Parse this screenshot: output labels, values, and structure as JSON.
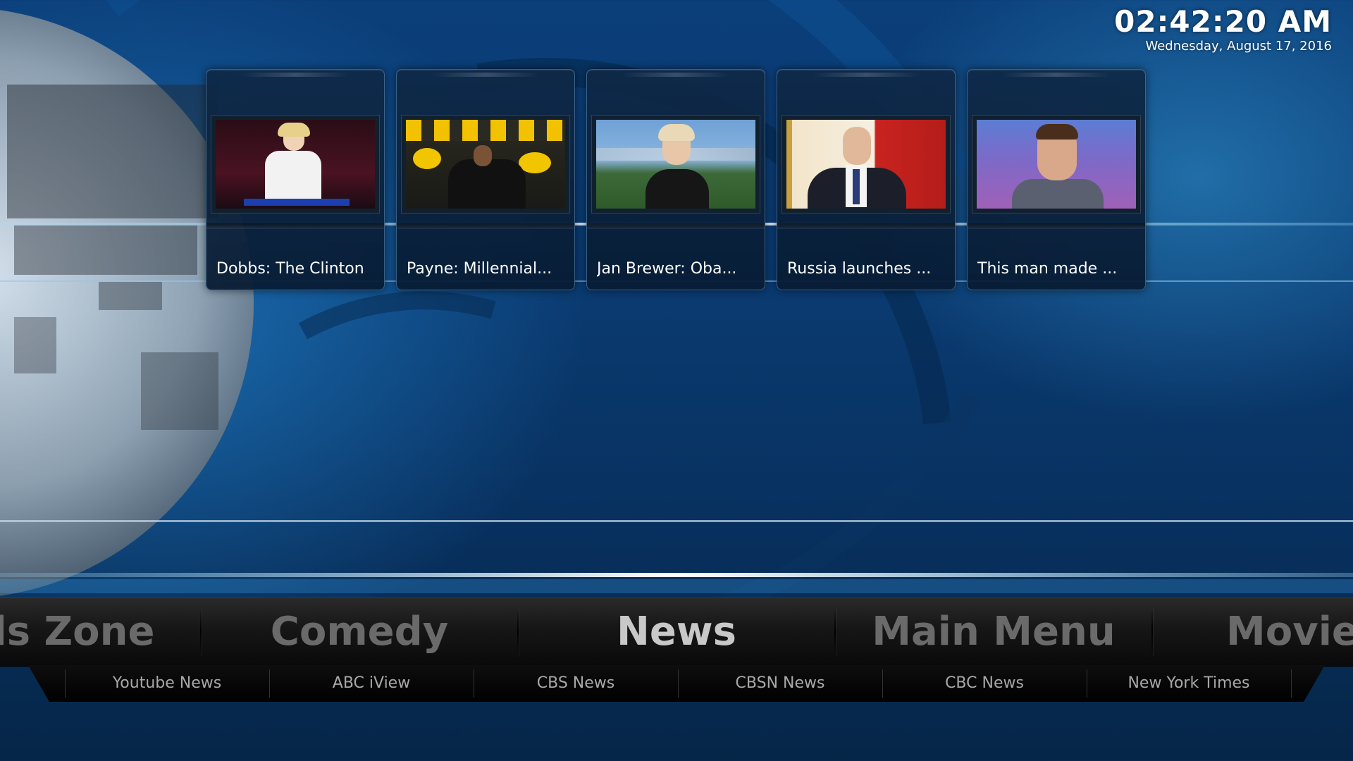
{
  "clock": {
    "time": "02:42:20 AM",
    "date": "Wednesday, August 17, 2016"
  },
  "videos": [
    {
      "title": "Dobbs: The Clinton"
    },
    {
      "title": "Payne: Millennial..."
    },
    {
      "title": "Jan Brewer: Oba..."
    },
    {
      "title": "Russia launches ..."
    },
    {
      "title": "This man made ..."
    }
  ],
  "main_menu": {
    "items": [
      {
        "label": "ls Zone",
        "active": false
      },
      {
        "label": "Comedy",
        "active": false
      },
      {
        "label": "News",
        "active": true
      },
      {
        "label": "Main Menu",
        "active": false
      },
      {
        "label": "Movie",
        "active": false
      }
    ]
  },
  "sub_menu": {
    "items": [
      {
        "label": "Youtube News"
      },
      {
        "label": "ABC iView"
      },
      {
        "label": "CBS News"
      },
      {
        "label": "CBSN News"
      },
      {
        "label": "CBC News"
      },
      {
        "label": "New York Times"
      }
    ]
  },
  "colors": {
    "background": "#0a3a70",
    "menu_active": "#c8c8c8",
    "menu_inactive": "#6a6a6a",
    "glow": "#8fd6ff"
  }
}
